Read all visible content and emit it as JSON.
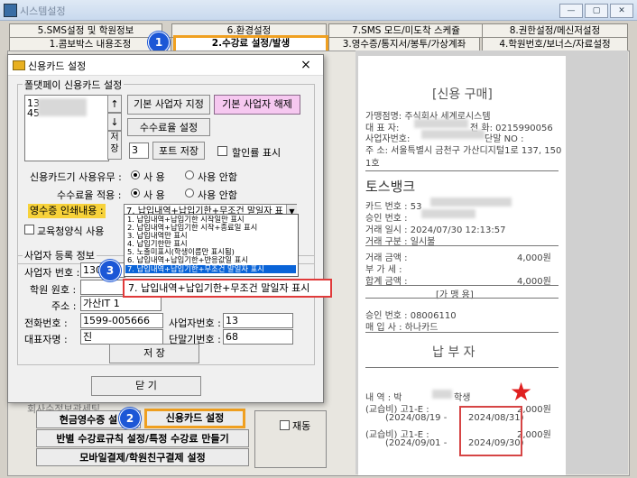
{
  "window": {
    "title": "시스템설정"
  },
  "tabs_row1": [
    {
      "label": "5.SMS설정 및 학원정보"
    },
    {
      "label": "6.환경설정"
    },
    {
      "label": "7.SMS 모드/미도착 스케쥴"
    },
    {
      "label": "8.권한설정/메신저설정"
    }
  ],
  "tabs_row2": [
    {
      "label": "1.콤보박스 내용조정"
    },
    {
      "label": "2.수강료 설정/발생"
    },
    {
      "label": "3.영수증/통지서/봉투/가상계좌"
    },
    {
      "label": "4.학원번호/보너스/자료설정"
    }
  ],
  "badges": [
    "1",
    "2",
    "3"
  ],
  "dialog": {
    "title": "신용카드 설정",
    "close": "×",
    "group1_label": "폴댓페이 신용카드 설정",
    "list_items": [
      "13",
      "45"
    ],
    "up_btn": "↑",
    "down_btn": "↓",
    "save_small_btn": "저장",
    "default_set_btn": "기본 사업자 지정",
    "default_unset_btn": "기본 사업자 해제",
    "fee_btn": "수수료율 설정",
    "port_value": "3",
    "port_btn": "포트 저장",
    "discount_label": "할인률 표시",
    "usage_label": "신용카드기 사용유무 :",
    "use": "사 용",
    "no_use": "사용 안함",
    "fee_apply_label": "수수료율 적용 :",
    "print_label": "영수증 인쇄내용 :",
    "print_selected": "7. 납입내역+납입기한+무조건 말일자 표",
    "edu_label": "교육청양식 사용",
    "dropdown_items": [
      "1. 납입내역+납입기한 시작일만 표시",
      "2. 납입내역+납입기한 시작+종료일 표시",
      "3. 납입내역만 표시",
      "4. 납입기한만 표시",
      "5. 노출미표시(학생이름만 표시됨)",
      "6. 납입내역+납입기한+반응값일 표시",
      "7. 납입내역+납입기한+무조건 말일자 표시"
    ],
    "callout_text": "7. 납입내역+납입기한+무조건 말일자 표시",
    "group2_label": "사업자 등록 정보",
    "biz_no_label": "사업자 번호 :",
    "biz_no_value": "130",
    "academy_no_label": "학원 원호 :",
    "address_label": "주소 :",
    "address_value": "가산IT 1",
    "phone_label": "전화번호 :",
    "phone_value": "1599-005666",
    "biz_no2_label": "사업자번호 :",
    "biz_no2_value": "13",
    "ceo_label": "대표자명 :",
    "ceo_value": "진",
    "terminal_label": "단말기번호 :",
    "terminal_value": "68",
    "save_btn": "저 장",
    "close_btn": "닫 기",
    "behind_text": "회사수정보관세팅"
  },
  "bottom": {
    "cash_btn": "현금영수증 설",
    "card_btn": "신용카드 설정",
    "rules_btn": "반별 수강료규칙 설정/특정 수강료 만들기",
    "mobile_btn": "모바일결제/학원친구결제 설정",
    "retry_label": "재동"
  },
  "receipt": {
    "title": "[신용 구매]",
    "l1": "가맹점명: 주식회사 세계로시스템",
    "l2a": "대 표 자:",
    "l2b": "전 화: 0215990056",
    "l3a": "사업자번호:",
    "l3b": "단말 NO :",
    "l4": "주 소: 서울특별시 금천구 가산디지털1로 137, 150",
    "l5": "1호",
    "bank": "토스뱅크",
    "card_no": "카드 번호 : 53",
    "approve_no": "승인 번호 :",
    "trans_date": "거래 일시 : 2024/07/30 12:13:57",
    "trans_type": "거래 구분 : 일시불",
    "amount_label": "거래 금액 :",
    "amount": "4,000원",
    "vat_label": "부 가 세 :",
    "total_label": "합계 금액 :",
    "total": "4,000원",
    "sign": "[가 맹 용]",
    "approval_no_label": "승인 번호 : 08006110",
    "acquirer": "매 입 사 : 하나카드",
    "pay_title": "납    부    자",
    "detail_label": "내   역 : 박",
    "student": "학생",
    "item1": "(교습비) 고1-E :",
    "item1_amt": "2,000원",
    "range1_start": "(2024/08/19 -",
    "range1_end": "2024/08/31)",
    "item2": "(교습비) 고1-E :",
    "item2_amt": "2,000원",
    "range2_start": "(2024/09/01 -",
    "range2_end": "2024/09/30)"
  }
}
